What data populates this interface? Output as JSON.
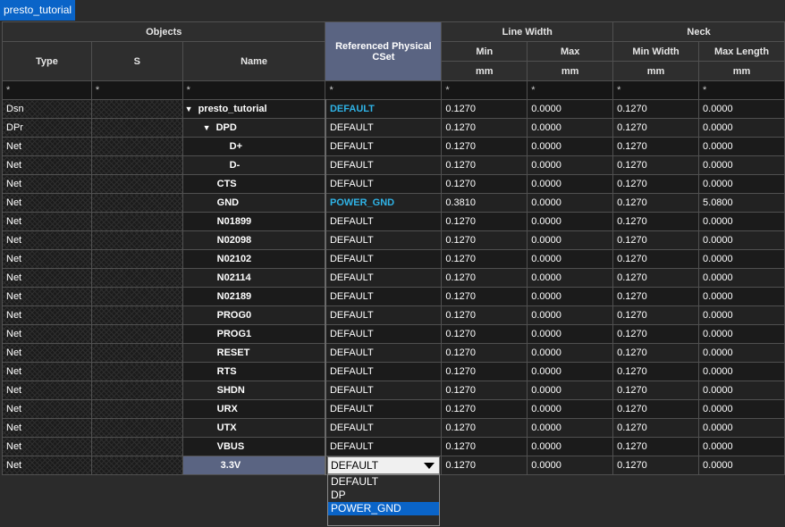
{
  "tab": {
    "label": "presto_tutorial"
  },
  "headers": {
    "objects": "Objects",
    "type": "Type",
    "s": "S",
    "name": "Name",
    "ref_cset": "Referenced Physical CSet",
    "line_width": "Line Width",
    "min": "Min",
    "max": "Max",
    "neck": "Neck",
    "min_width": "Min Width",
    "max_length": "Max Length",
    "unit": "mm"
  },
  "filter": "*",
  "rows": [
    {
      "type": "Dsn",
      "name": "presto_tutorial",
      "cset": "DEFAULT",
      "lw_min": "0.1270",
      "lw_max": "0.0000",
      "neck_min": "0.1270",
      "neck_max": "0.0000"
    },
    {
      "type": "DPr",
      "name": "DPD",
      "cset": "DEFAULT",
      "lw_min": "0.1270",
      "lw_max": "0.0000",
      "neck_min": "0.1270",
      "neck_max": "0.0000"
    },
    {
      "type": "Net",
      "name": "D+",
      "cset": "DEFAULT",
      "lw_min": "0.1270",
      "lw_max": "0.0000",
      "neck_min": "0.1270",
      "neck_max": "0.0000"
    },
    {
      "type": "Net",
      "name": "D-",
      "cset": "DEFAULT",
      "lw_min": "0.1270",
      "lw_max": "0.0000",
      "neck_min": "0.1270",
      "neck_max": "0.0000"
    },
    {
      "type": "Net",
      "name": "CTS",
      "cset": "DEFAULT",
      "lw_min": "0.1270",
      "lw_max": "0.0000",
      "neck_min": "0.1270",
      "neck_max": "0.0000"
    },
    {
      "type": "Net",
      "name": "GND",
      "cset": "POWER_GND",
      "lw_min": "0.3810",
      "lw_max": "0.0000",
      "neck_min": "0.1270",
      "neck_max": "5.0800"
    },
    {
      "type": "Net",
      "name": "N01899",
      "cset": "DEFAULT",
      "lw_min": "0.1270",
      "lw_max": "0.0000",
      "neck_min": "0.1270",
      "neck_max": "0.0000"
    },
    {
      "type": "Net",
      "name": "N02098",
      "cset": "DEFAULT",
      "lw_min": "0.1270",
      "lw_max": "0.0000",
      "neck_min": "0.1270",
      "neck_max": "0.0000"
    },
    {
      "type": "Net",
      "name": "N02102",
      "cset": "DEFAULT",
      "lw_min": "0.1270",
      "lw_max": "0.0000",
      "neck_min": "0.1270",
      "neck_max": "0.0000"
    },
    {
      "type": "Net",
      "name": "N02114",
      "cset": "DEFAULT",
      "lw_min": "0.1270",
      "lw_max": "0.0000",
      "neck_min": "0.1270",
      "neck_max": "0.0000"
    },
    {
      "type": "Net",
      "name": "N02189",
      "cset": "DEFAULT",
      "lw_min": "0.1270",
      "lw_max": "0.0000",
      "neck_min": "0.1270",
      "neck_max": "0.0000"
    },
    {
      "type": "Net",
      "name": "PROG0",
      "cset": "DEFAULT",
      "lw_min": "0.1270",
      "lw_max": "0.0000",
      "neck_min": "0.1270",
      "neck_max": "0.0000"
    },
    {
      "type": "Net",
      "name": "PROG1",
      "cset": "DEFAULT",
      "lw_min": "0.1270",
      "lw_max": "0.0000",
      "neck_min": "0.1270",
      "neck_max": "0.0000"
    },
    {
      "type": "Net",
      "name": "RESET",
      "cset": "DEFAULT",
      "lw_min": "0.1270",
      "lw_max": "0.0000",
      "neck_min": "0.1270",
      "neck_max": "0.0000"
    },
    {
      "type": "Net",
      "name": "RTS",
      "cset": "DEFAULT",
      "lw_min": "0.1270",
      "lw_max": "0.0000",
      "neck_min": "0.1270",
      "neck_max": "0.0000"
    },
    {
      "type": "Net",
      "name": "SHDN",
      "cset": "DEFAULT",
      "lw_min": "0.1270",
      "lw_max": "0.0000",
      "neck_min": "0.1270",
      "neck_max": "0.0000"
    },
    {
      "type": "Net",
      "name": "URX",
      "cset": "DEFAULT",
      "lw_min": "0.1270",
      "lw_max": "0.0000",
      "neck_min": "0.1270",
      "neck_max": "0.0000"
    },
    {
      "type": "Net",
      "name": "UTX",
      "cset": "DEFAULT",
      "lw_min": "0.1270",
      "lw_max": "0.0000",
      "neck_min": "0.1270",
      "neck_max": "0.0000"
    },
    {
      "type": "Net",
      "name": "VBUS",
      "cset": "DEFAULT",
      "lw_min": "0.1270",
      "lw_max": "0.0000",
      "neck_min": "0.1270",
      "neck_max": "0.0000"
    },
    {
      "type": "Net",
      "name": "3.3V",
      "cset": "",
      "lw_min": "0.1270",
      "lw_max": "0.0000",
      "neck_min": "0.1270",
      "neck_max": "0.0000"
    }
  ],
  "dropdown": {
    "value": "DEFAULT",
    "options": [
      "DEFAULT",
      "DP",
      "POWER_GND"
    ],
    "highlighted": "POWER_GND"
  },
  "colors": {
    "accent": "#0a64c8",
    "cset_highlight": "#2fb3e6",
    "header_sel": "#5a6482"
  }
}
